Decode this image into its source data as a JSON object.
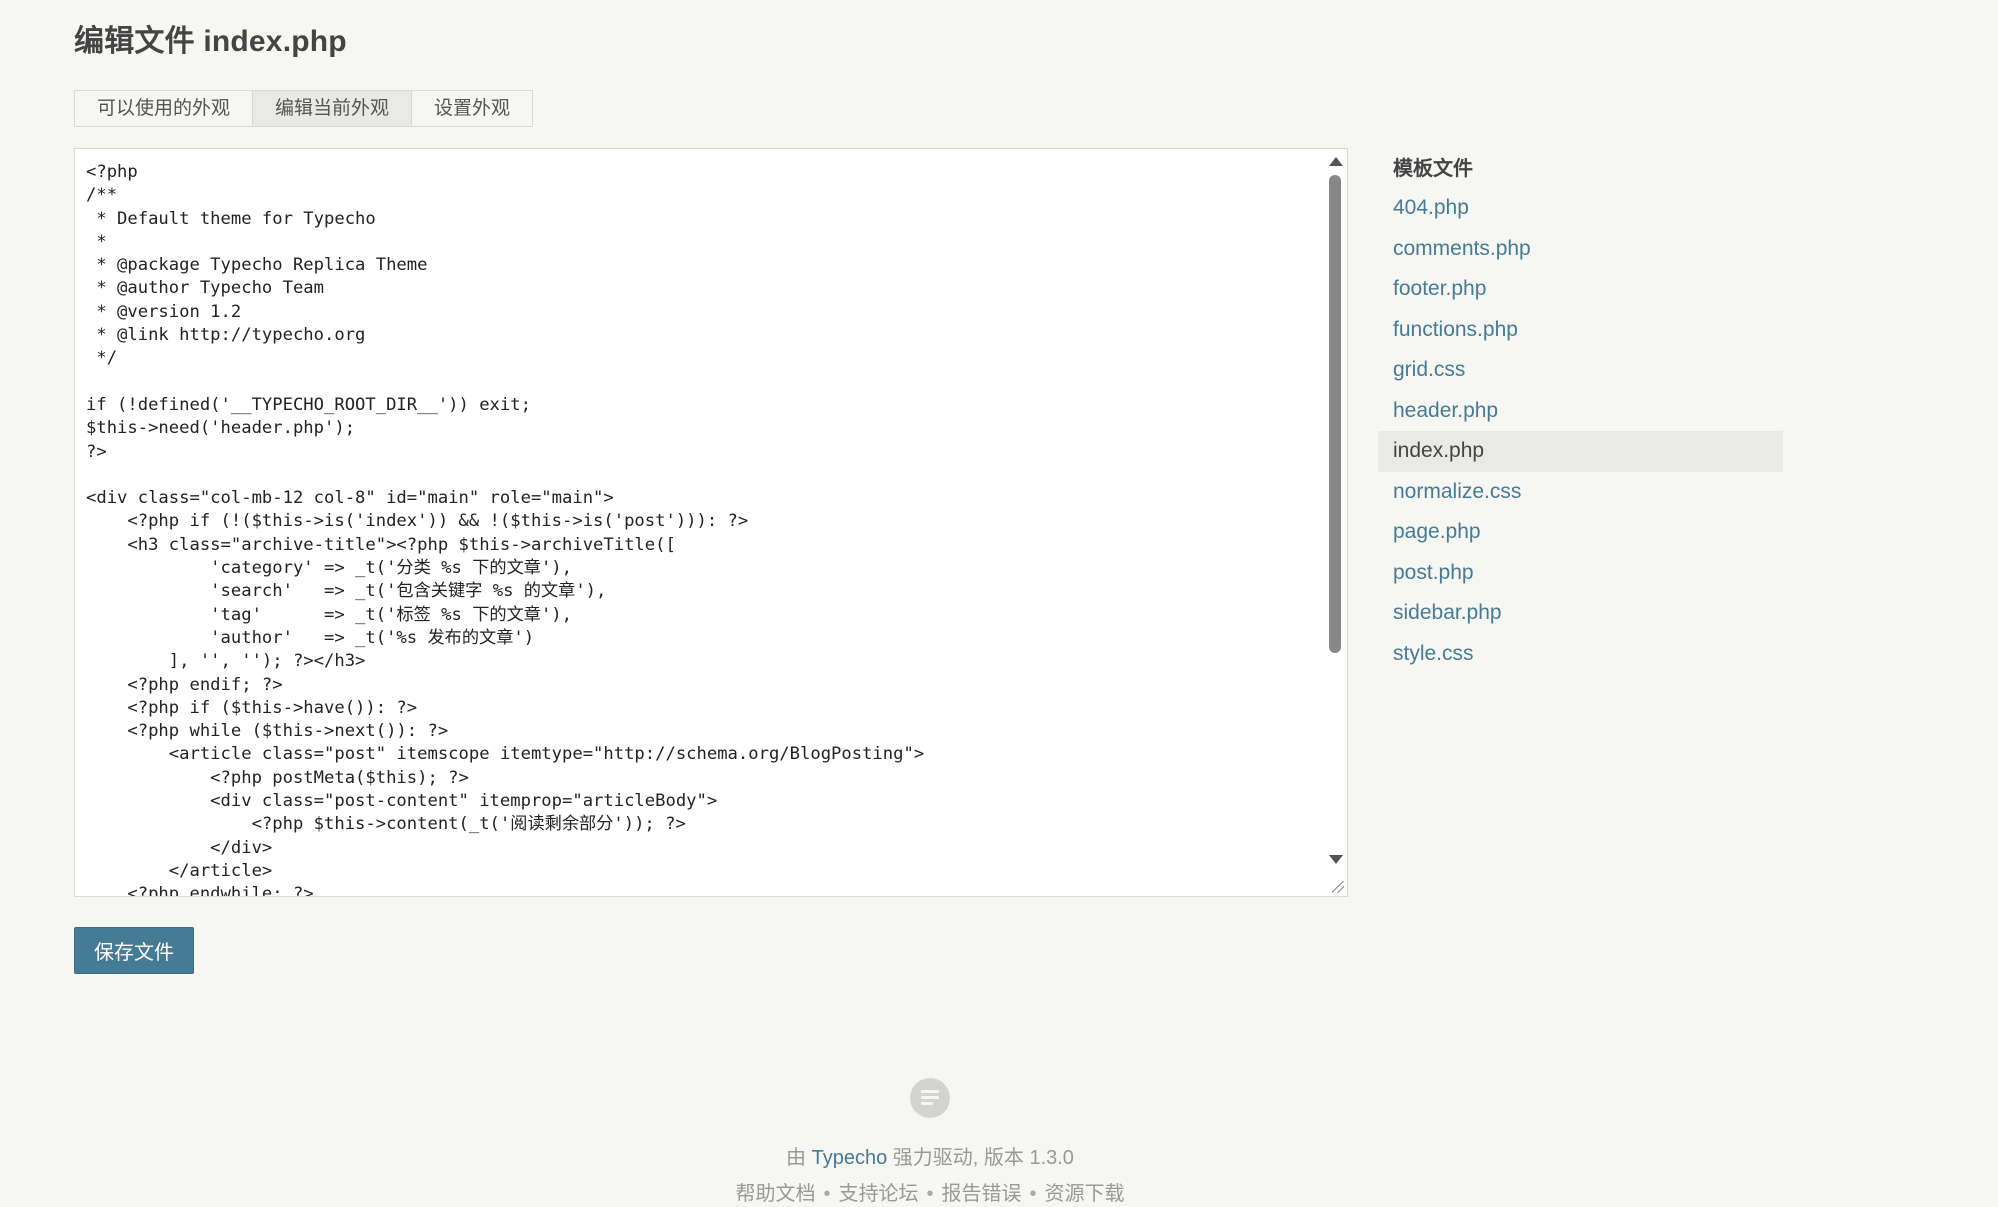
{
  "page": {
    "title": "编辑文件 index.php"
  },
  "tabs": [
    {
      "label": "可以使用的外观"
    },
    {
      "label": "编辑当前外观"
    },
    {
      "label": "设置外观"
    }
  ],
  "editor": {
    "code": "<?php\n/**\n * Default theme for Typecho\n *\n * @package Typecho Replica Theme\n * @author Typecho Team\n * @version 1.2\n * @link http://typecho.org\n */\n\nif (!defined('__TYPECHO_ROOT_DIR__')) exit;\n$this->need('header.php');\n?>\n\n<div class=\"col-mb-12 col-8\" id=\"main\" role=\"main\">\n    <?php if (!($this->is('index')) && !($this->is('post'))): ?>\n    <h3 class=\"archive-title\"><?php $this->archiveTitle([\n            'category' => _t('分类 %s 下的文章'),\n            'search'   => _t('包含关键字 %s 的文章'),\n            'tag'      => _t('标签 %s 下的文章'),\n            'author'   => _t('%s 发布的文章')\n        ], '', ''); ?></h3>\n    <?php endif; ?>\n    <?php if ($this->have()): ?>\n    <?php while ($this->next()): ?>\n        <article class=\"post\" itemscope itemtype=\"http://schema.org/BlogPosting\">\n            <?php postMeta($this); ?>\n            <div class=\"post-content\" itemprop=\"articleBody\">\n                <?php $this->content(_t('阅读剩余部分')); ?>\n            </div>\n        </article>\n    <?php endwhile; ?>"
  },
  "save_button": {
    "label": "保存文件"
  },
  "sidebar": {
    "title": "模板文件",
    "files": [
      {
        "name": "404.php"
      },
      {
        "name": "comments.php"
      },
      {
        "name": "footer.php"
      },
      {
        "name": "functions.php"
      },
      {
        "name": "grid.css"
      },
      {
        "name": "header.php"
      },
      {
        "name": "index.php"
      },
      {
        "name": "normalize.css"
      },
      {
        "name": "page.php"
      },
      {
        "name": "post.php"
      },
      {
        "name": "sidebar.php"
      },
      {
        "name": "style.css"
      }
    ],
    "current_index": 6
  },
  "footer": {
    "logo_icon": "typecho-logo-icon",
    "credit_prefix": "由",
    "credit_link": "Typecho",
    "credit_suffix": "强力驱动, 版本 1.3.0",
    "links": [
      {
        "label": "帮助文档"
      },
      {
        "label": "支持论坛"
      },
      {
        "label": "报告错误"
      },
      {
        "label": "资源下载"
      }
    ],
    "separator": "•"
  },
  "colors": {
    "accent": "#467b96",
    "background": "#f6f6f3",
    "active_bg": "#e9e9e6"
  }
}
